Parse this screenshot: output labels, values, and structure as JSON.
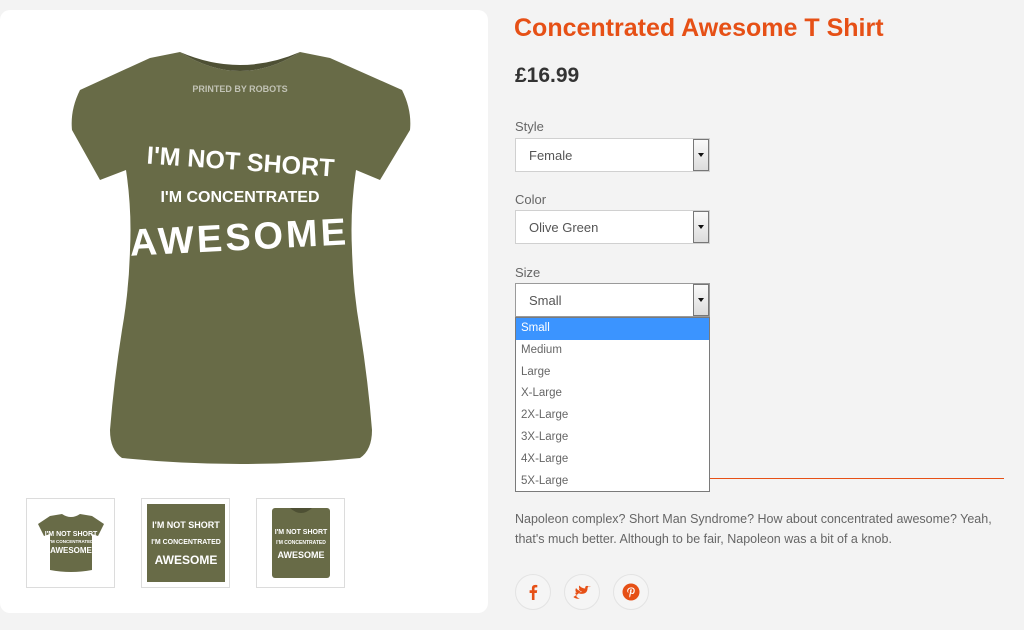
{
  "product": {
    "title": "Concentrated Awesome T Shirt",
    "price": "£16.99",
    "shirt_color": "#686b47",
    "print_text": {
      "line1": "I'M NOT SHORT",
      "line2": "I'M CONCENTRATED",
      "line3": "AWESOME"
    },
    "neck_label": "PRINTED BY ROBOTS"
  },
  "options": {
    "style": {
      "label": "Style",
      "value": "Female"
    },
    "color": {
      "label": "Color",
      "value": "Olive Green"
    },
    "size": {
      "label": "Size",
      "value": "Small",
      "options": [
        "Small",
        "Medium",
        "Large",
        "X-Large",
        "2X-Large",
        "3X-Large",
        "4X-Large",
        "5X-Large"
      ]
    }
  },
  "description": "Napoleon complex? Short Man Syndrome? How about concentrated awesome? Yeah, that's much better. Although to be fair, Napoleon was a bit of a knob.",
  "social": {
    "icons": [
      "facebook-icon",
      "twitter-icon",
      "pinterest-icon"
    ],
    "brand_color": "#e65016"
  },
  "colors": {
    "accent": "#e65016",
    "dropdown_highlight": "#3b94ff"
  }
}
